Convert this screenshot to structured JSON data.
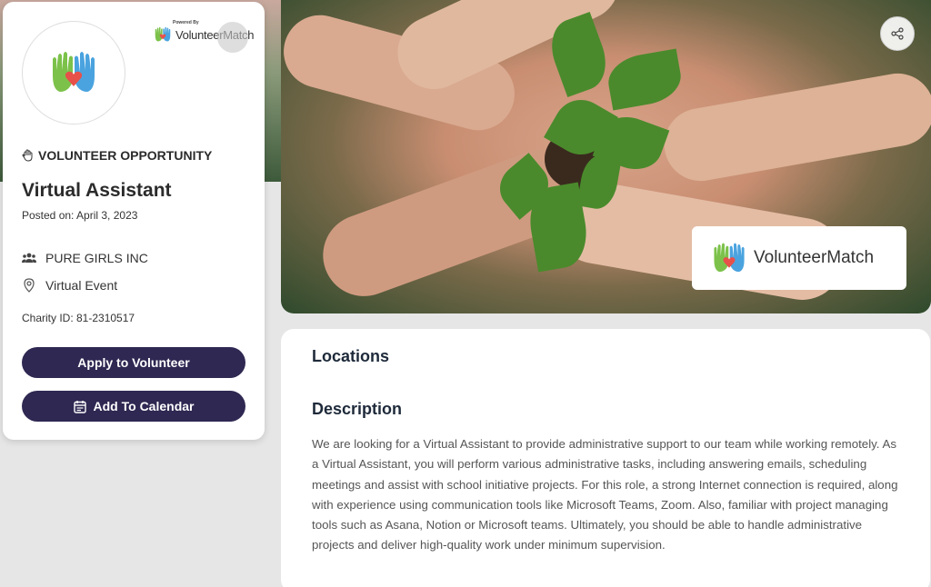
{
  "card": {
    "powered_by": "Powered By",
    "powered_brand": "VolunteerMatch",
    "category": "VOLUNTEER OPPORTUNITY",
    "title": "Virtual Assistant",
    "posted": "Posted on: April 3, 2023",
    "organization": "PURE GIRLS INC",
    "location": "Virtual Event",
    "charity_id": "Charity ID: 81-2310517",
    "apply_label": "Apply to Volunteer",
    "calendar_label": "Add To Calendar"
  },
  "hero": {
    "badge_brand": "VolunteerMatch"
  },
  "content": {
    "locations_heading": "Locations",
    "description_heading": "Description",
    "description": "We are looking for a Virtual Assistant to provide administrative support to our team while working remotely. As a Virtual Assistant, you will perform various administrative tasks, including answering emails, scheduling meetings and assist with school initiative projects. For this role, a strong Internet connection is required, along with experience using communication tools like Microsoft Teams, Zoom. Also, familiar with project managing tools such as Asana, Notion or Microsoft teams. Ultimately, you should be able to handle administrative projects and deliver high-quality work under minimum supervision."
  },
  "colors": {
    "button": "#2e2852",
    "heading": "#1e2a3a",
    "logo_green": "#7cc24a",
    "logo_blue": "#4aa3df",
    "logo_heart": "#e8504a"
  },
  "icons": [
    "hand-icon",
    "people-icon",
    "map-pin-icon",
    "calendar-icon",
    "share-icon",
    "volunteermatch-logo-icon"
  ]
}
